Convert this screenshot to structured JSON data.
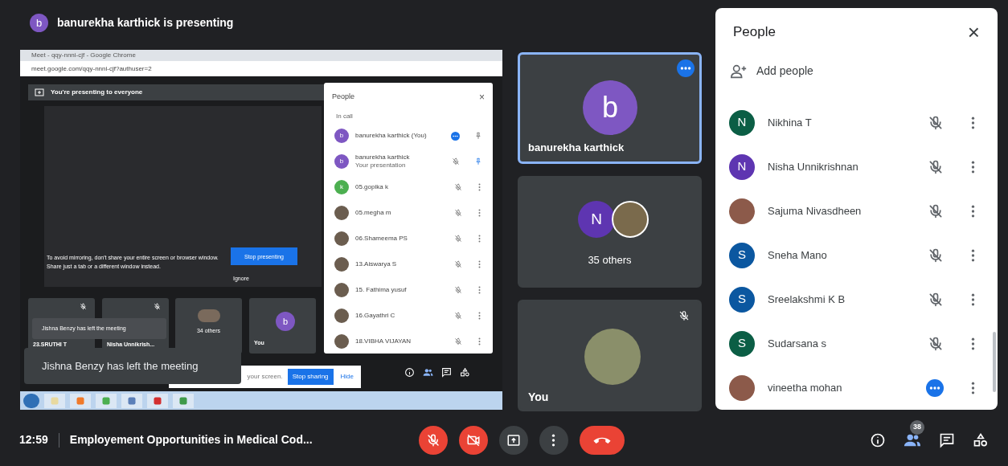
{
  "header": {
    "avatar_letter": "b",
    "title": "banurekha karthick is presenting"
  },
  "shared_screen": {
    "browser_title": "Meet - qqy-nnni-cjf - Google Chrome",
    "url": "meet.google.com/qqy-nnni-cjf?authuser=2",
    "banner": "You're presenting to everyone",
    "warning": "To avoid mirroring, don't share your entire screen or browser window. Share just a tab or a different window instead.",
    "stop_presenting": "Stop presenting",
    "ignore": "Ignore",
    "mini_tiles": [
      {
        "kind": "muted",
        "label": "23.SRUTHI T"
      },
      {
        "kind": "muted",
        "label": "Nisha Unnikrish..."
      },
      {
        "kind": "group",
        "label": "34 others"
      },
      {
        "kind": "self",
        "label": "You",
        "letter": "b"
      }
    ],
    "small_toast": "Jishna Benzy has left the meeting",
    "toast": "Jishna Benzy has left the meeting",
    "share_bar": {
      "text": "your screen.",
      "stop": "Stop sharing",
      "hide": "Hide"
    },
    "people_panel": {
      "title": "People",
      "close": "×",
      "section": "In call",
      "members": [
        {
          "kind": "self",
          "name": "banurekha karthick (You)",
          "letter": "b",
          "color": "#7e57c2"
        },
        {
          "kind": "presentation",
          "name": "banurekha karthick",
          "subtitle": "Your presentation",
          "letter": "b",
          "color": "#7e57c2"
        },
        {
          "kind": "member",
          "name": "05.gopika k",
          "letter": "k",
          "color": "#4caf50"
        },
        {
          "kind": "member",
          "name": "05.megha m"
        },
        {
          "kind": "member",
          "name": "06.Shameema PS"
        },
        {
          "kind": "member",
          "name": "13.Aiswarya S"
        },
        {
          "kind": "member",
          "name": "15. Fathima yusuf"
        },
        {
          "kind": "member",
          "name": "16.Gayathri C"
        },
        {
          "kind": "member",
          "name": "18.VIBHA VIJAYAN"
        }
      ]
    }
  },
  "tiles": [
    {
      "kind": "person",
      "letter": "b",
      "name": "banurekha karthick",
      "selected": true
    },
    {
      "kind": "group",
      "letter": "N",
      "caption": "35 others",
      "selected": false
    },
    {
      "kind": "self",
      "name": "You",
      "selected": false
    }
  ],
  "people": {
    "title": "People",
    "close": "×",
    "add": "Add people",
    "members": [
      {
        "name": "Nikhina T",
        "letter": "N",
        "color": "#0b5e45",
        "kind": "muted"
      },
      {
        "name": "Nisha Unnikrishnan",
        "letter": "N",
        "color": "#5e35b1",
        "kind": "muted"
      },
      {
        "name": "Sajuma Nivasdheen",
        "kind": "muted"
      },
      {
        "name": "Sneha Mano",
        "letter": "S",
        "color": "#0b57a0",
        "kind": "muted"
      },
      {
        "name": "Sreelakshmi K B",
        "letter": "S",
        "color": "#0b57a0",
        "kind": "muted"
      },
      {
        "name": "Sudarsana s",
        "letter": "S",
        "color": "#0b5e45",
        "kind": "muted"
      },
      {
        "name": "vineetha mohan",
        "kind": "active"
      }
    ]
  },
  "bottom_bar": {
    "time": "12:59",
    "meeting_title": "Employement Opportunities in Medical Cod...",
    "mic_on": false,
    "camera_on": false,
    "people_count": "38"
  }
}
